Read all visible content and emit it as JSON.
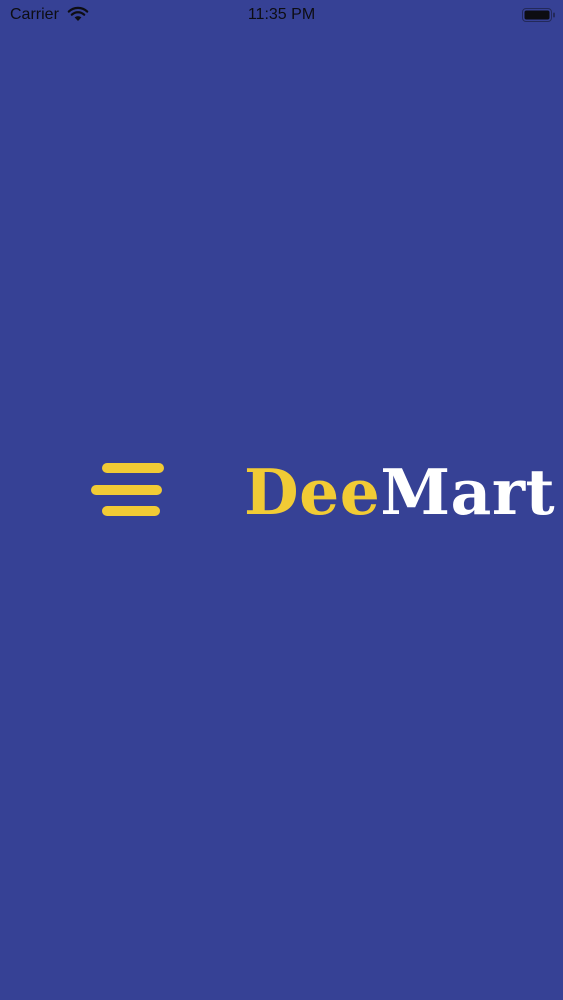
{
  "status_bar": {
    "carrier": "Carrier",
    "time": "11:35 PM",
    "wifi_icon": "wifi-icon",
    "battery_icon": "battery-icon"
  },
  "splash": {
    "background_color": "#364195",
    "logo": {
      "part_one": "Dee",
      "part_two": "Mart",
      "part_one_color": "#f1cb35",
      "part_two_color": "#ffffff",
      "icon": "speed-lines-icon"
    }
  }
}
